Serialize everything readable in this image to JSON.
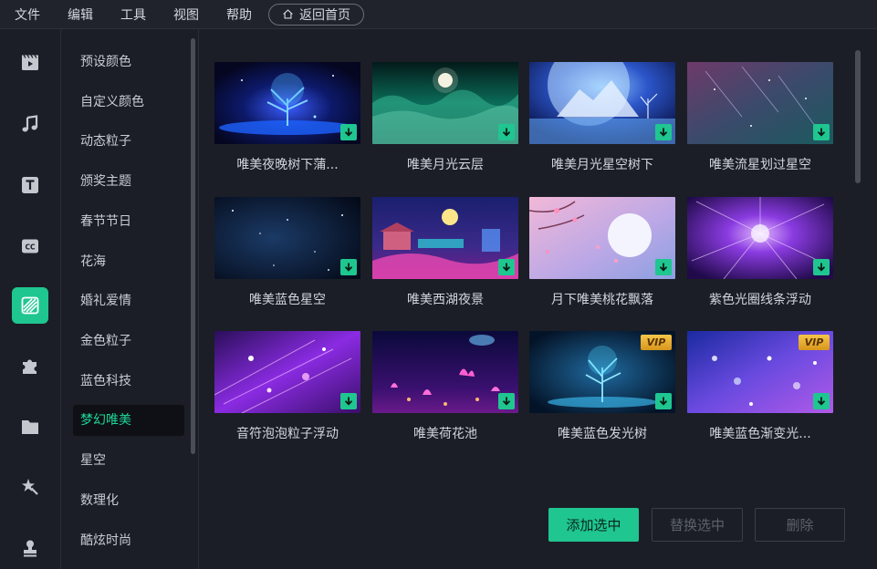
{
  "menu": {
    "items": [
      "文件",
      "编辑",
      "工具",
      "视图",
      "帮助"
    ],
    "home_button": "返回首页"
  },
  "rail": {
    "icons": [
      "media-icon",
      "music-icon",
      "text-icon",
      "subtitle-icon",
      "background-icon",
      "plugin-icon",
      "folder-icon",
      "effects-icon",
      "stamp-icon"
    ],
    "active_index": 4,
    "accent": "#1fc690"
  },
  "categories": {
    "items": [
      "预设颜色",
      "自定义颜色",
      "动态粒子",
      "颁奖主题",
      "春节节日",
      "花海",
      "婚礼爱情",
      "金色粒子",
      "蓝色科技",
      "梦幻唯美",
      "星空",
      "数理化",
      "酷炫时尚"
    ],
    "active_index": 9
  },
  "grid": {
    "items": [
      {
        "title": "唯美夜晚树下蒲...",
        "badge": "download"
      },
      {
        "title": "唯美月光云层",
        "badge": "download"
      },
      {
        "title": "唯美月光星空树下",
        "badge": "download"
      },
      {
        "title": "唯美流星划过星空",
        "badge": "download"
      },
      {
        "title": "唯美蓝色星空",
        "badge": "download"
      },
      {
        "title": "唯美西湖夜景",
        "badge": "download"
      },
      {
        "title": "月下唯美桃花飘落",
        "badge": "download"
      },
      {
        "title": "紫色光圈线条浮动",
        "badge": "download"
      },
      {
        "title": "音符泡泡粒子浮动",
        "badge": "download"
      },
      {
        "title": "唯美荷花池",
        "badge": "download"
      },
      {
        "title": "唯美蓝色发光树",
        "badge": "vip"
      },
      {
        "title": "唯美蓝色渐变光...",
        "badge": "vip"
      }
    ],
    "vip_label": "VIP"
  },
  "actions": {
    "add_selected": "添加选中",
    "replace_selected": "替换选中",
    "delete": "删除"
  }
}
